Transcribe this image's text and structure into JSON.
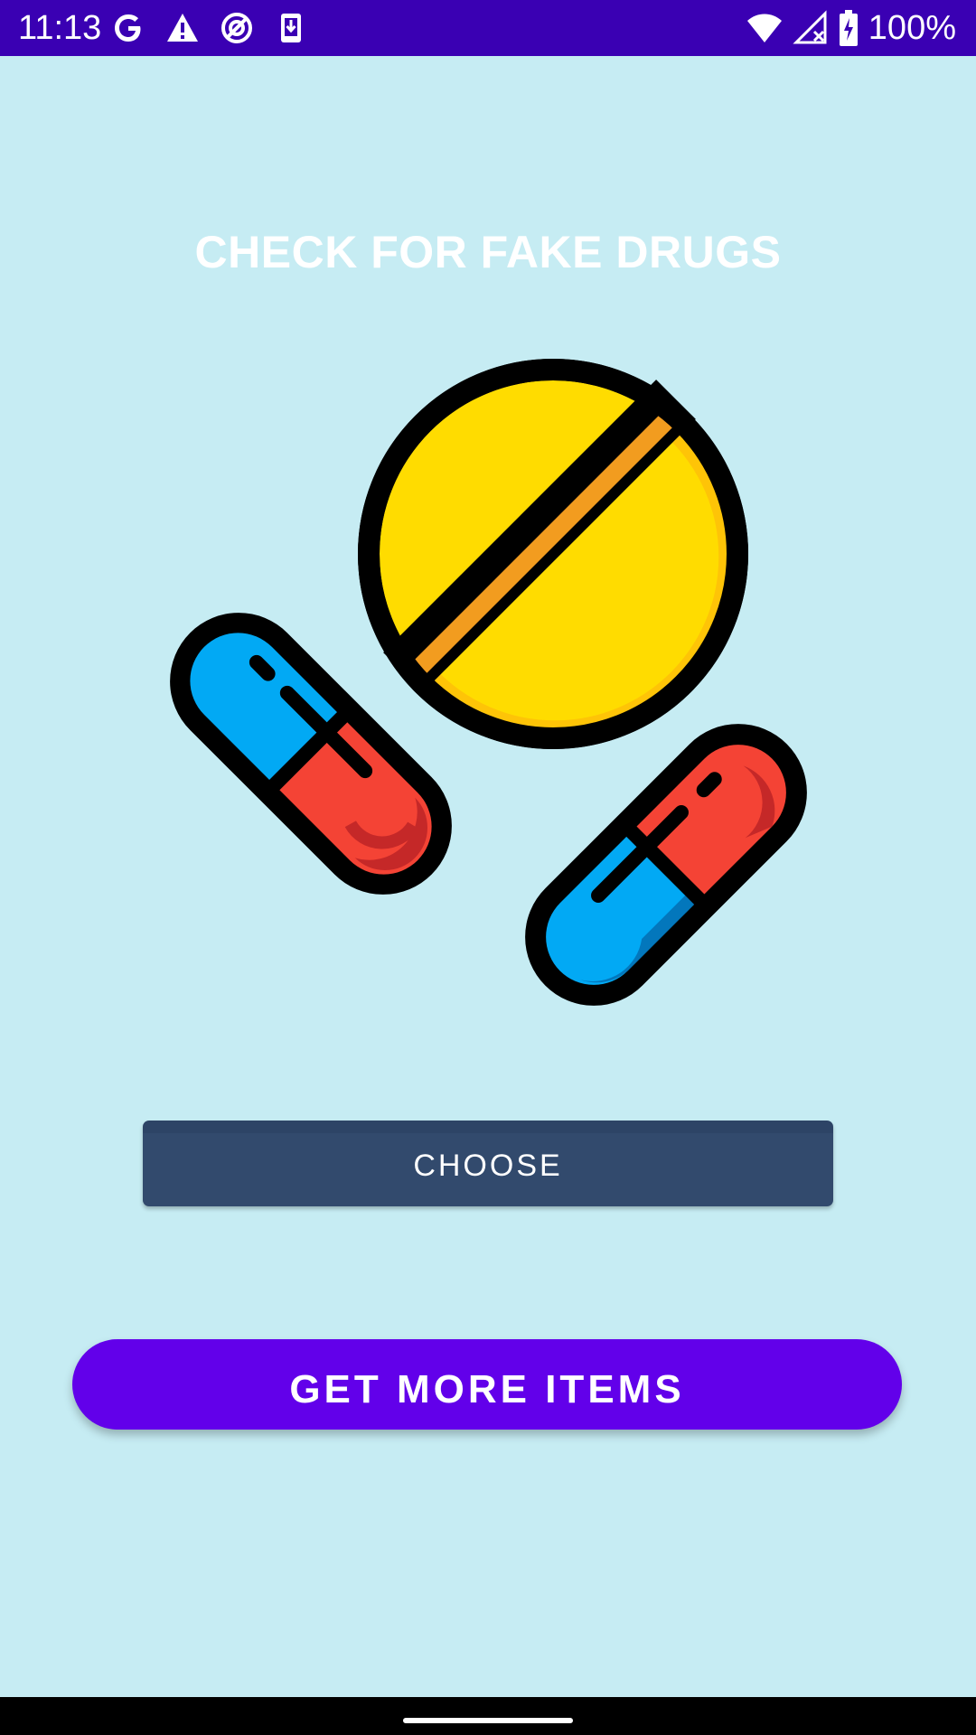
{
  "status_bar": {
    "time": "11:13",
    "battery": "100%",
    "background": "#3a00b3",
    "left_icons": [
      "google-icon",
      "warning-icon",
      "data-saver-icon",
      "download-icon"
    ],
    "right_icons": [
      "wifi-icon",
      "signal-icon",
      "battery-icon"
    ]
  },
  "main": {
    "title": "CHECK FOR FAKE DRUGS",
    "illustration": "pills-icon",
    "choose_label": "CHOOSE",
    "more_label": "GET MORE ITEMS"
  },
  "colors": {
    "background": "#c6ecf3",
    "choose_button": "#324a6d",
    "more_button": "#6200ea",
    "pill_yellow": "#ffdc00",
    "pill_orange": "#f29c1f",
    "capsule_blue": "#02a9f4",
    "capsule_red": "#f44335"
  }
}
